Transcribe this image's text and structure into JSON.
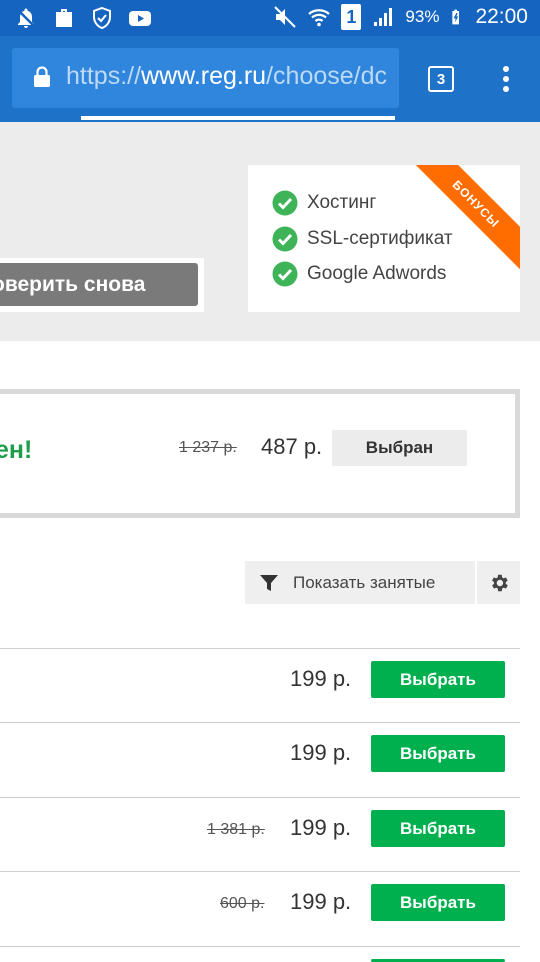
{
  "status_bar": {
    "icons": [
      "notifications-off-icon",
      "briefcase-icon",
      "shield-icon",
      "youtube-icon"
    ],
    "right_icons": [
      "mute-icon",
      "wifi-icon",
      "sim-icon",
      "signal-icon",
      "battery-charging-icon"
    ],
    "sim_slot": "1",
    "battery": "93%",
    "time": "22:00"
  },
  "browser": {
    "url_prefix": "https://",
    "url_domain": "www.reg.ru",
    "url_path": "/choose/dc",
    "tab_count": "3"
  },
  "search": {
    "check_again_label": "оверить снова"
  },
  "bonuses": {
    "ribbon": "БОНУСЫ",
    "items": [
      "Хостинг",
      "SSL-сертификат",
      "Google Adwords"
    ]
  },
  "selected": {
    "status_text": "ен!",
    "old_price": "1 237 р.",
    "price": "487 р.",
    "button_label": "Выбран"
  },
  "filter": {
    "show_taken_label": "Показать занятые"
  },
  "results": [
    {
      "old_price": "",
      "price": "199 р.",
      "button_label": "Выбрать"
    },
    {
      "old_price": "",
      "price": "199 р.",
      "button_label": "Выбрать"
    },
    {
      "old_price": "1 381 р.",
      "price": "199 р.",
      "button_label": "Выбрать"
    },
    {
      "old_price": "600 р.",
      "price": "199 р.",
      "button_label": "Выбрать"
    }
  ],
  "colors": {
    "status_bar": "#1565c0",
    "chrome_bar": "#1e73c8",
    "accent_green": "#00b04f",
    "ribbon_orange": "#ff6d00"
  }
}
